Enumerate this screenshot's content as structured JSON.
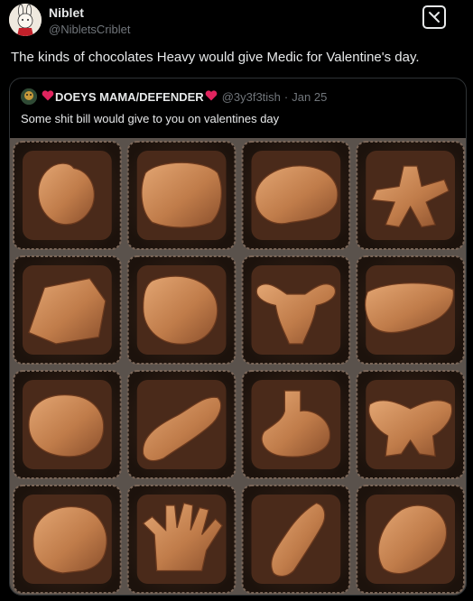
{
  "post": {
    "author_name": "Niblet",
    "author_handle": "@NibletsCriblet",
    "text": "The kinds of chocolates Heavy would give Medic for Valentine's day."
  },
  "quoted_post": {
    "author_name": "DOEYS MAMA/DEFENDER",
    "author_handle": "@3y3f3tish",
    "separator": "·",
    "date": "Jan 25",
    "text": "Some shit bill would give to you on valentines day"
  },
  "icons": {
    "heart_color": "#e0245e",
    "grok": "grok-icon"
  },
  "photo": {
    "chocolates": [
      [
        "heart",
        "brain-top",
        "brain-side",
        "vertebra"
      ],
      [
        "lung",
        "lungs",
        "uterus",
        "liver"
      ],
      [
        "eye",
        "pancreas",
        "stomach",
        "pelvis"
      ],
      [
        "skull",
        "hand",
        "spine",
        "ear"
      ]
    ]
  },
  "colors": {
    "background": "#000000",
    "border": "#2f3336",
    "text": "#e7e9ea",
    "muted": "#71767b",
    "chocolate_light": "#d2925e",
    "chocolate_dark": "#4a2a1a"
  }
}
